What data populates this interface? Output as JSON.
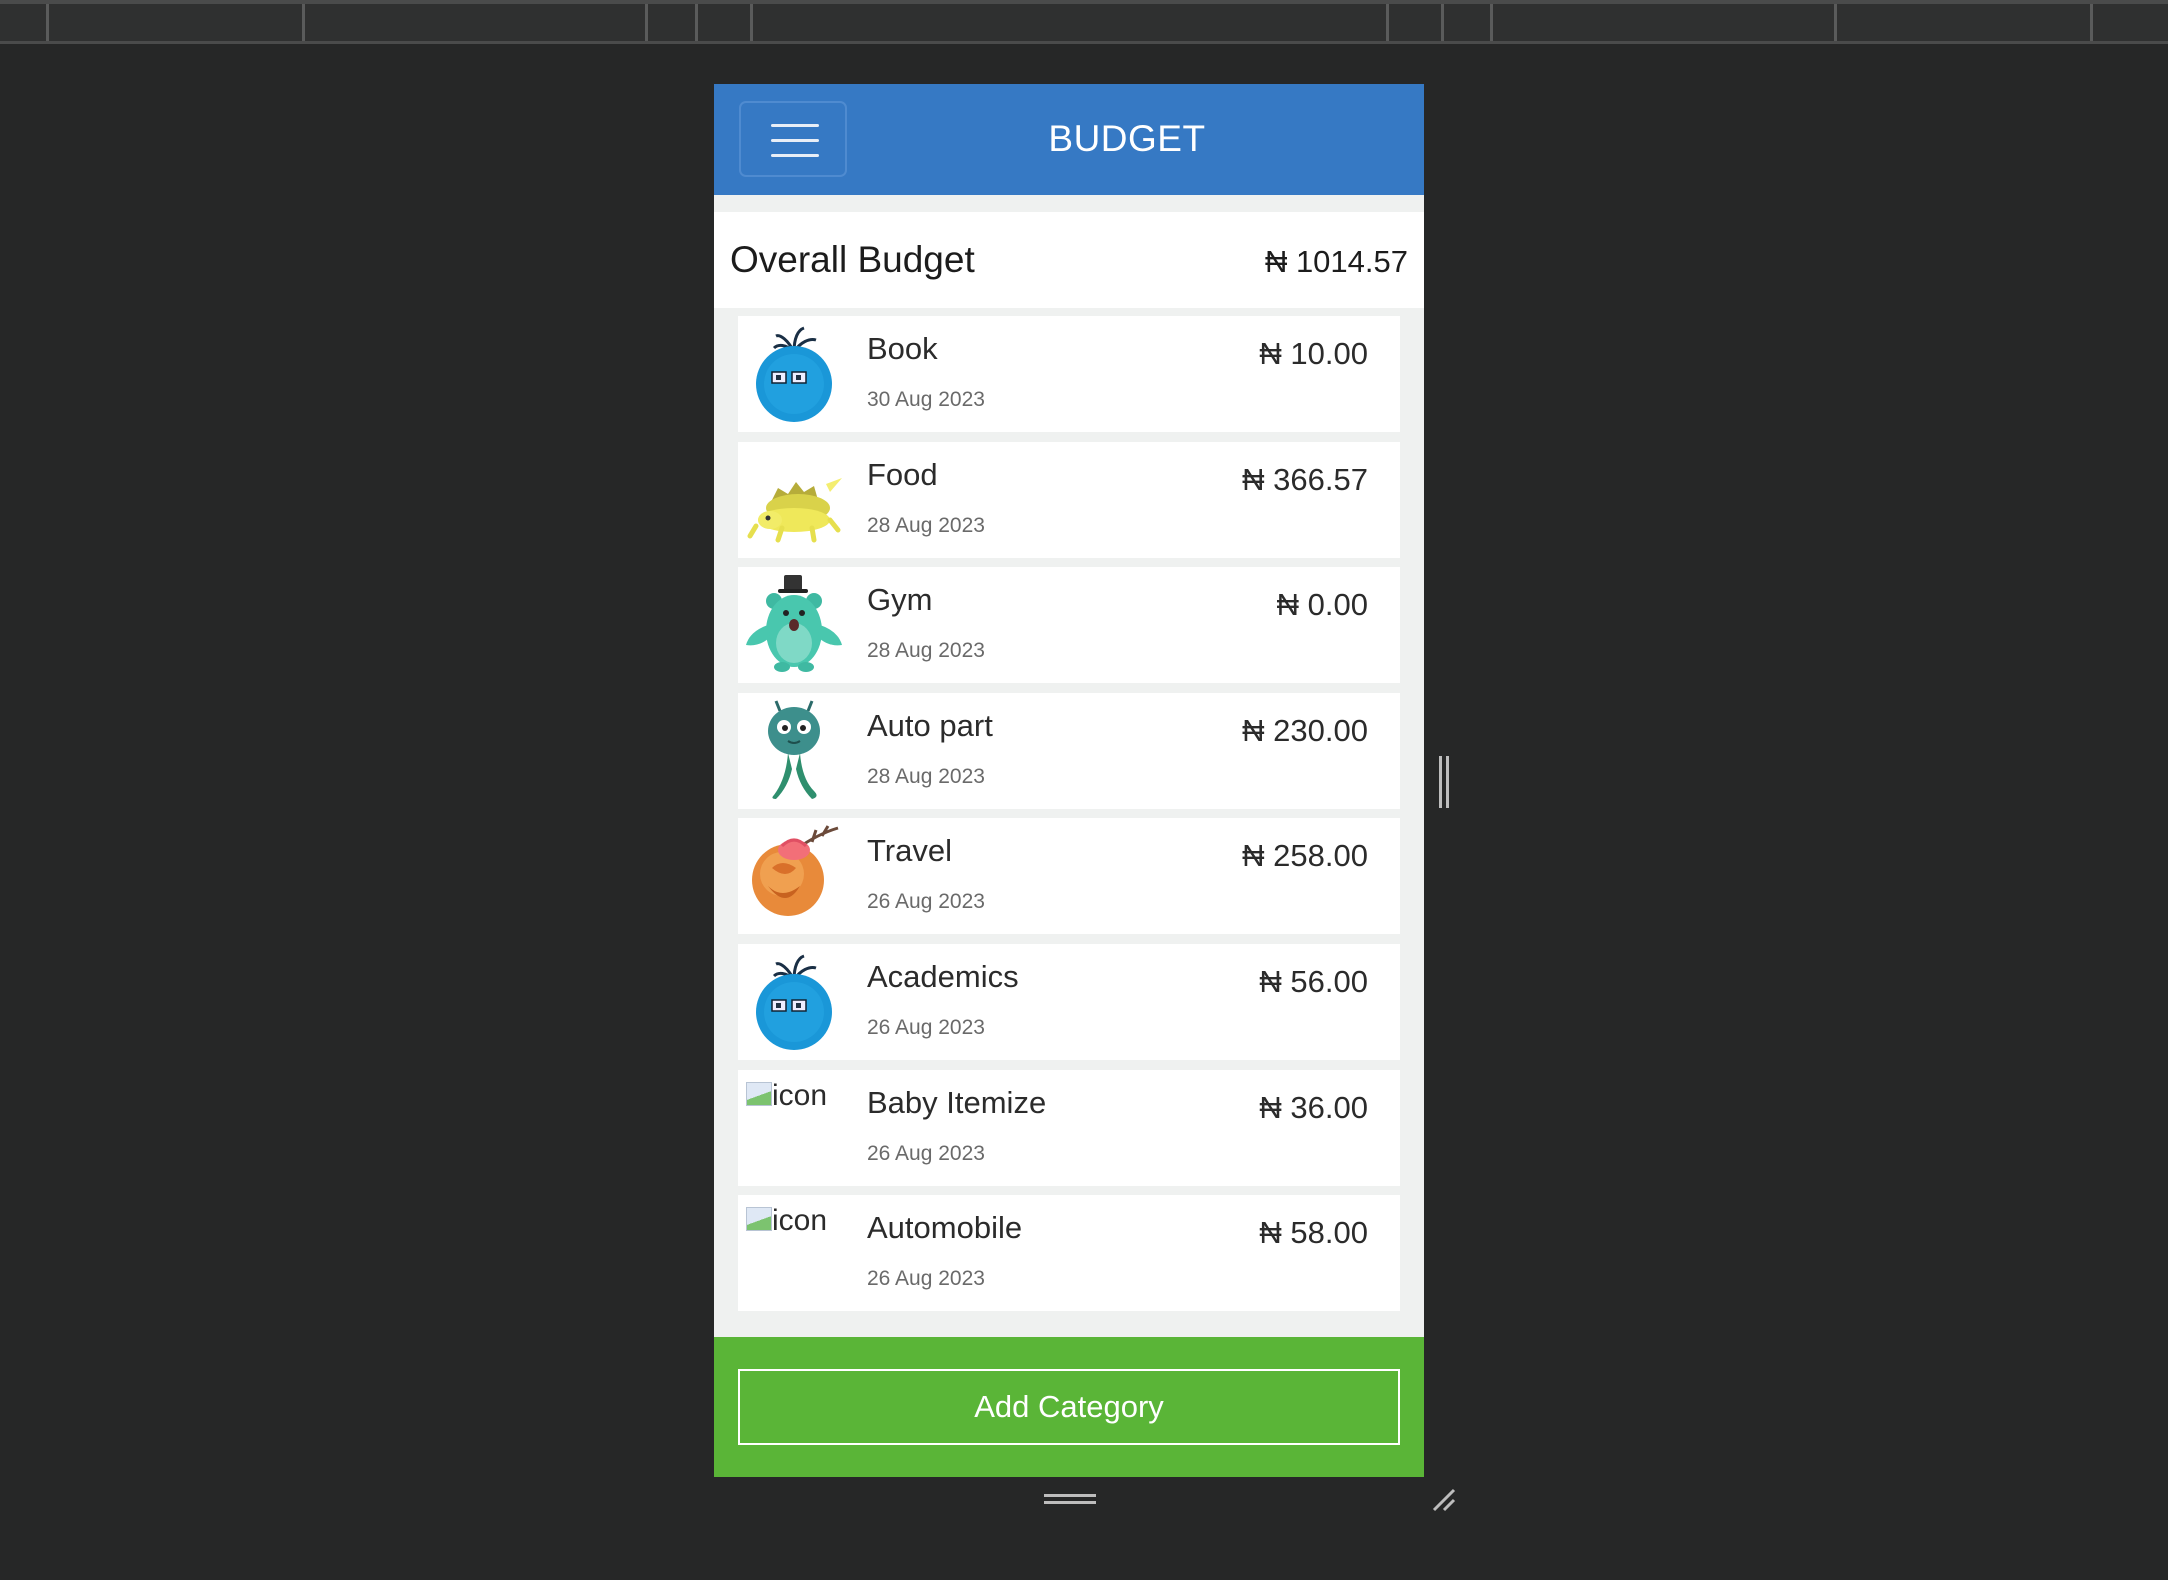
{
  "header": {
    "title": "BUDGET",
    "menu_icon": "hamburger-menu-icon",
    "color": "#3679c4"
  },
  "overall": {
    "label": "Overall Budget",
    "amount": "₦ 1014.57"
  },
  "categories": [
    {
      "name": "Book",
      "date": "30 Aug 2023",
      "amount": "₦ 10.00",
      "icon": "blue-monster-icon"
    },
    {
      "name": "Food",
      "date": "28 Aug 2023",
      "amount": "₦ 366.57",
      "icon": "yellow-turtle-icon"
    },
    {
      "name": "Gym",
      "date": "28 Aug 2023",
      "amount": "₦ 0.00",
      "icon": "teal-bear-icon"
    },
    {
      "name": "Auto part",
      "date": "28 Aug 2023",
      "amount": "₦ 230.00",
      "icon": "teal-alien-icon"
    },
    {
      "name": "Travel",
      "date": "26 Aug 2023",
      "amount": "₦ 258.00",
      "icon": "orange-rose-icon"
    },
    {
      "name": "Academics",
      "date": "26 Aug 2023",
      "amount": "₦ 56.00",
      "icon": "blue-monster-icon"
    },
    {
      "name": "Baby Itemize",
      "date": "26 Aug 2023",
      "amount": "₦ 36.00",
      "icon": "broken-image-icon",
      "alt": "icon"
    },
    {
      "name": "Automobile",
      "date": "26 Aug 2023",
      "amount": "₦ 58.00",
      "icon": "broken-image-icon",
      "alt": "icon"
    }
  ],
  "footer": {
    "add_label": "Add Category",
    "color": "#5ab537"
  }
}
